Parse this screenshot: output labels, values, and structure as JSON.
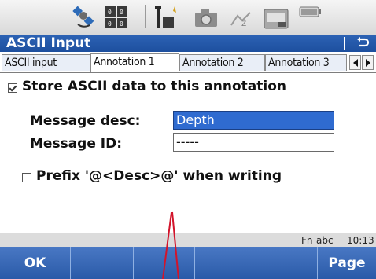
{
  "statusbar": {
    "icons": [
      {
        "name": "satellite-icon"
      },
      {
        "name": "positioning-status-icon"
      },
      {
        "name": "radio-link-icon"
      },
      {
        "name": "camera-icon"
      },
      {
        "name": "signal-icon"
      },
      {
        "name": "memory-card-icon"
      },
      {
        "name": "battery-icon"
      }
    ]
  },
  "title": {
    "text": "ASCII Input",
    "back_icon": "back-arrow-icon"
  },
  "tabs": {
    "items": [
      {
        "label": "ASCII input"
      },
      {
        "label": "Annotation 1",
        "active": true
      },
      {
        "label": "Annotation 2"
      },
      {
        "label": "Annotation 3"
      }
    ],
    "prev_icon": "tab-left-arrow-icon",
    "next_icon": "tab-right-arrow-icon"
  },
  "form": {
    "store_checkbox": {
      "label": "Store ASCII data to this annotation",
      "checked": true
    },
    "message_desc": {
      "label": "Message desc:",
      "value": "Depth"
    },
    "message_id": {
      "label": "Message ID:",
      "value": "-----"
    },
    "prefix_checkbox": {
      "label": "Prefix '@<Desc>@' when writing",
      "checked": false
    }
  },
  "infoline": {
    "fn": "Fn",
    "input_mode": "abc",
    "time": "10:13"
  },
  "softkeys": [
    {
      "label": "OK"
    },
    {
      "label": ""
    },
    {
      "label": ""
    },
    {
      "label": ""
    },
    {
      "label": ""
    },
    {
      "label": "Page"
    }
  ],
  "colors": {
    "titlebar": "#1d4f9e",
    "softbar": "#2a5aa8",
    "selected_field": "#2f6bd0",
    "annotation_line": "#d2142b"
  }
}
